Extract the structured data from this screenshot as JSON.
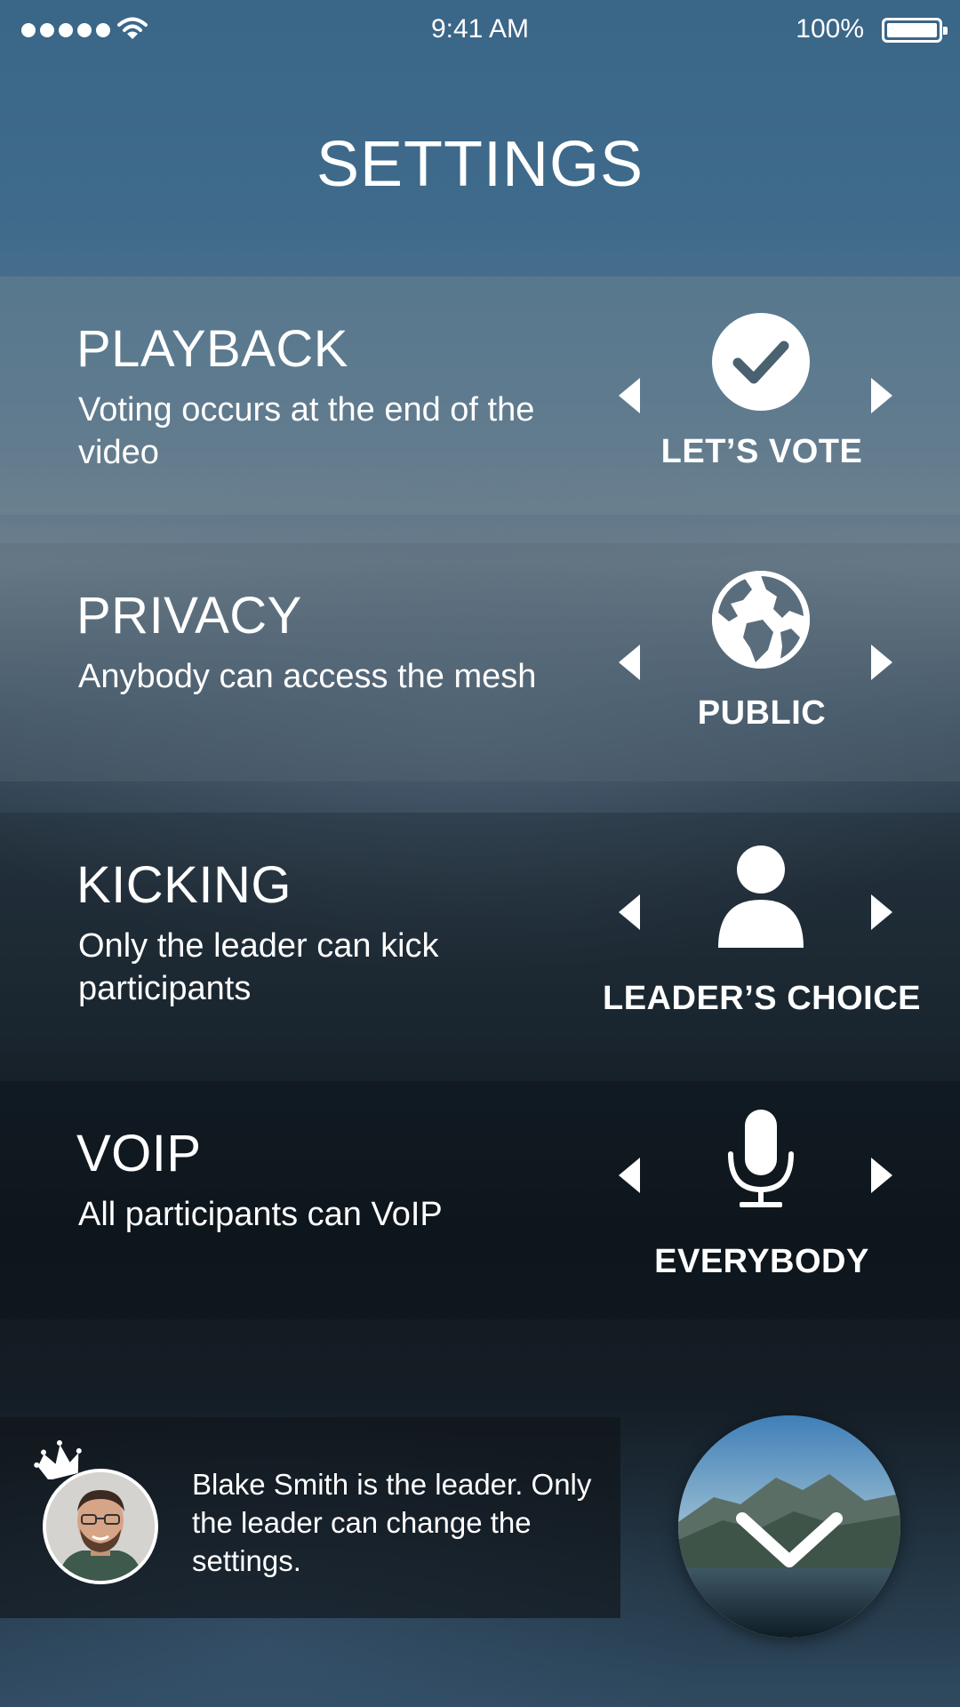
{
  "status_bar": {
    "time": "9:41 AM",
    "battery_percent": "100%",
    "signal_bars": 5
  },
  "page_title": "SETTINGS",
  "settings": [
    {
      "title": "PLAYBACK",
      "description": "Voting occurs at the end of the video",
      "option": "LET’S VOTE",
      "icon": "check-circle-icon"
    },
    {
      "title": "PRIVACY",
      "description": "Anybody can access the mesh",
      "option": "PUBLIC",
      "icon": "globe-icon"
    },
    {
      "title": "KICKING",
      "description": "Only the leader can kick participants",
      "option": "LEADER’S CHOICE",
      "icon": "person-icon"
    },
    {
      "title": "VOIP",
      "description": "All participants can VoIP",
      "option": "EVERYBODY",
      "icon": "microphone-icon"
    }
  ],
  "leader": {
    "message": "Blake Smith is the leader. Only the leader can change the settings."
  },
  "colors": {
    "accent": "#ffffff",
    "top_bg": "#3f6a8b",
    "bottom_bg": "#121a20"
  }
}
